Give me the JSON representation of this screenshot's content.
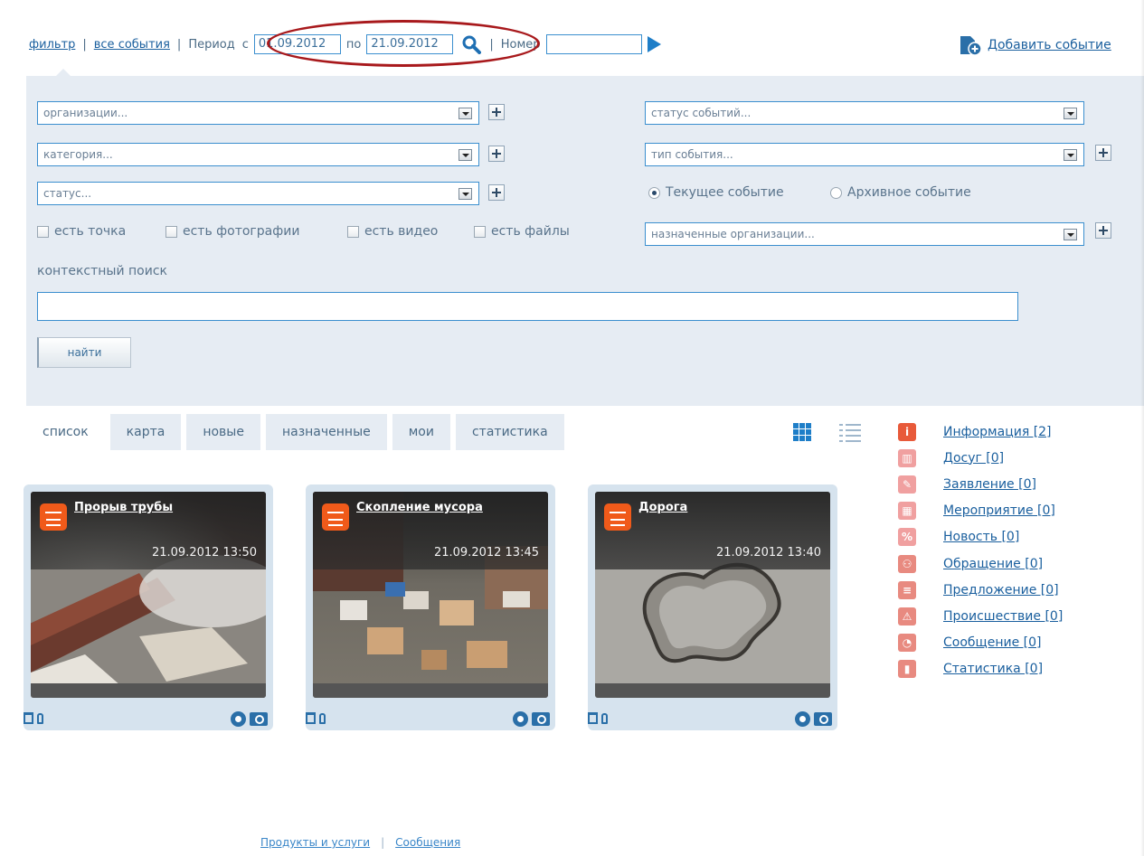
{
  "topbar": {
    "filter_link": "фильтр",
    "all_events_link": "все события",
    "sep": "|",
    "period_label": "Период",
    "from_label": "с",
    "date_from": "01.09.2012",
    "to_label": "по",
    "date_to": "21.09.2012",
    "number_label": "Номер",
    "number_value": "",
    "add_event": "Добавить событие"
  },
  "filters": {
    "organizations": "организации...",
    "category": "категория...",
    "status": "статус...",
    "event_status": "статус событий...",
    "event_type": "тип события...",
    "assigned_orgs": "назначенные организации...",
    "checkboxes": [
      "есть точка",
      "есть фотографии",
      "есть видео",
      "есть файлы"
    ],
    "radio_current": "Текущее событие",
    "radio_archive": "Архивное событие",
    "context_label": "контекстный поиск",
    "context_value": "",
    "find_button": "найти"
  },
  "tabs": [
    "список",
    "карта",
    "новые",
    "назначенные",
    "мои",
    "статистика"
  ],
  "cards": [
    {
      "title": "Прорыв трубы",
      "datetime": "21.09.2012 13:50"
    },
    {
      "title": "Скопление мусора",
      "datetime": "21.09.2012 13:45"
    },
    {
      "title": "Дорога",
      "datetime": "21.09.2012 13:40"
    }
  ],
  "categories": [
    {
      "label": "Информация [2]",
      "icon": "info-icon",
      "color": "#e85a3a",
      "glyph": "i"
    },
    {
      "label": "Досуг [0]",
      "icon": "museum-icon",
      "color": "#f0a0a0",
      "glyph": "▥"
    },
    {
      "label": "Заявление [0]",
      "icon": "edit-icon",
      "color": "#f0a0a0",
      "glyph": "✎"
    },
    {
      "label": "Мероприятие [0]",
      "icon": "calendar-icon",
      "color": "#f0a0a0",
      "glyph": "▦"
    },
    {
      "label": "Новость [0]",
      "icon": "news-icon",
      "color": "#f0a0a0",
      "glyph": "%"
    },
    {
      "label": "Обращение [0]",
      "icon": "people-icon",
      "color": "#e88a80",
      "glyph": "⚇"
    },
    {
      "label": "Предложение [0]",
      "icon": "document-icon",
      "color": "#e88a80",
      "glyph": "≡"
    },
    {
      "label": "Происшествие [0]",
      "icon": "warning-icon",
      "color": "#e88a80",
      "glyph": "⚠"
    },
    {
      "label": "Сообщение [0]",
      "icon": "chat-icon",
      "color": "#e88a80",
      "glyph": "◔"
    },
    {
      "label": "Статистика [0]",
      "icon": "chart-icon",
      "color": "#e88a80",
      "glyph": "▮"
    }
  ],
  "footer": {
    "products": "Продукты и услуги",
    "sep": "|",
    "messages": "Сообщения"
  }
}
